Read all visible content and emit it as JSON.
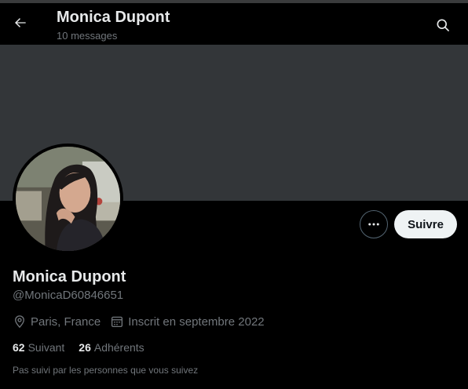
{
  "header": {
    "title": "Monica Dupont",
    "subtitle": "10 messages",
    "back_icon": "arrow-left-icon",
    "search_icon": "search-icon"
  },
  "profile": {
    "name": "Monica Dupont",
    "handle": "@MonicaD60846651",
    "location": "Paris, France",
    "joined": "Inscrit en septembre 2022",
    "following_count": "62",
    "following_label": "Suivant",
    "followers_count": "26",
    "followers_label": "Adhérents",
    "not_followed_note": "Pas suivi par les personnes que vous suivez"
  },
  "actions": {
    "follow_label": "Suivre",
    "more_icon": "more-dots-icon"
  },
  "colors": {
    "background": "#000000",
    "banner": "#333639",
    "primary_text": "#e7e9ea",
    "secondary_text": "#71767b",
    "follow_button_bg": "#eff3f4"
  }
}
